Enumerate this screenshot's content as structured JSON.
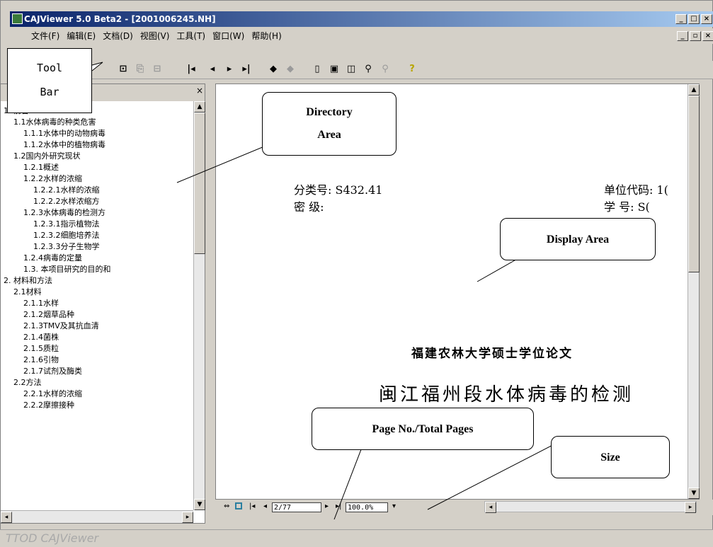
{
  "window": {
    "title": "CAJViewer 5.0 Beta2 - [2001006245.NH]",
    "controls": {
      "minimize": "_",
      "maximize": "□",
      "close": "×"
    },
    "doc_controls": {
      "minimize": "_",
      "restore": "▫",
      "close": "×"
    }
  },
  "menu": {
    "items": [
      "文件(F)",
      "编辑(E)",
      "文档(D)",
      "视图(V)",
      "工具(T)",
      "窗口(W)",
      "帮助(H)"
    ]
  },
  "toolbar": {
    "icons": [
      "select-text-icon",
      "copy-icon",
      "snapshot-icon",
      "first-page-icon",
      "previous-page-icon",
      "next-page-icon",
      "last-page-icon",
      "back-icon",
      "forward-icon",
      "single-page-icon",
      "continuous-page-icon",
      "facing-page-icon",
      "find-icon",
      "find-next-icon",
      "help-icon"
    ]
  },
  "directory": {
    "close_label": "×",
    "items": [
      "1. 前言",
      "1.1水体病毒的种类危害",
      "1.1.1水体中的动物病毒",
      "1.1.2水体中的植物病毒",
      "1.2国内外研究现状",
      "1.2.1概述",
      "1.2.2水样的浓缩",
      "1.2.2.1水样的浓缩",
      "1.2.2.2水样浓缩方",
      "1.2.3水体病毒的检测方",
      "1.2.3.1指示植物法",
      "1.2.3.2细胞培养法",
      "1.2.3.3分子生物学",
      "1.2.4病毒的定量",
      "1.3. 本项目研究的目的和",
      "2. 材料和方法",
      "2.1材料",
      "2.1.1水样",
      "2.1.2烟草品种",
      "2.1.3TMV及其抗血清",
      "2.1.4菌株",
      "2.1.5质粒",
      "2.1.6引物",
      "2.1.7试剂及酶类",
      "2.2方法",
      "2.2.1水样的浓缩",
      "2.2.2摩擦接种"
    ]
  },
  "page": {
    "class_no_label": "分类号: S432.41",
    "secret_label": "密   级:",
    "unit_code_label": "单位代码: 1(",
    "student_no_label": "学     号: S(",
    "university": "福建农林大学硕士学位论文",
    "thesis_title": "闽江福州段水体病毒的检测"
  },
  "navbar": {
    "page_field": "2/77",
    "zoom_field": "100.0%"
  },
  "status": {
    "text": "TTOD CAJViewer"
  },
  "callouts": {
    "toolbar": "Tool\nBar",
    "directory": "Directory\nArea",
    "display": "Display Area",
    "page_no": "Page No./Total Pages",
    "size": "Size"
  }
}
